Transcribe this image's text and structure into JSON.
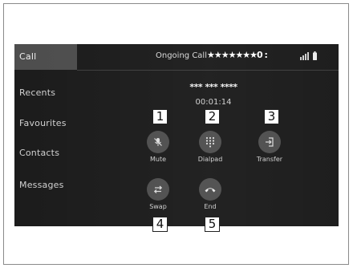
{
  "sidebar": {
    "items": [
      {
        "label": "Call",
        "active": true
      },
      {
        "label": "Recents"
      },
      {
        "label": "Favourites"
      },
      {
        "label": "Contacts"
      },
      {
        "label": "Messages"
      }
    ]
  },
  "header": {
    "title": "Ongoing Call",
    "masked_name": "★★★★★★★0 :",
    "signal_icon": "signal-bars-icon",
    "battery_icon": "battery-icon"
  },
  "call": {
    "number": "*** *** ****",
    "timer": "00:01:14"
  },
  "controls": [
    {
      "label": "Mute",
      "icon": "mute-icon"
    },
    {
      "label": "Dialpad",
      "icon": "dialpad-icon"
    },
    {
      "label": "Transfer",
      "icon": "transfer-icon"
    },
    {
      "label": "Swap",
      "icon": "swap-icon"
    },
    {
      "label": "End",
      "icon": "end-call-icon"
    }
  ],
  "callouts": [
    "1",
    "2",
    "3",
    "4",
    "5"
  ],
  "colors": {
    "screen_bg": "#171717",
    "active_item": "#4a4a4a",
    "button_bg": "#4b4b4b",
    "text": "#d0d0d0"
  }
}
